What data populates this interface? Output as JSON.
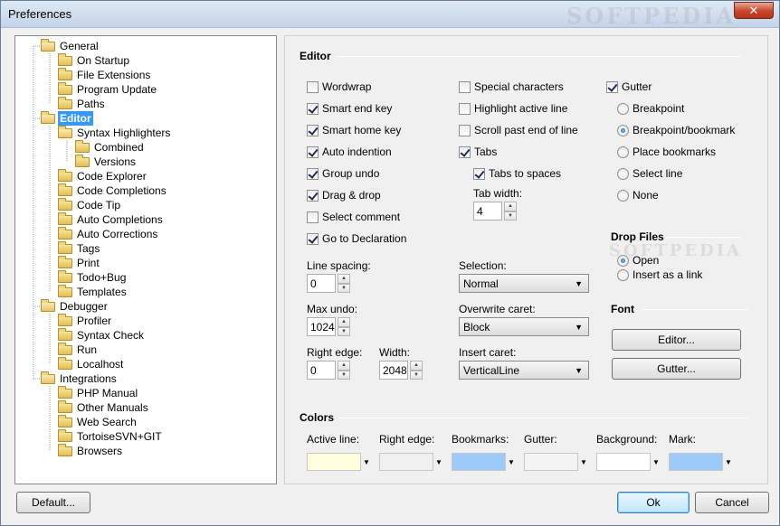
{
  "window": {
    "title": "Preferences",
    "close_glyph": "✕"
  },
  "watermark": "SOFTPEDIA",
  "tree": [
    {
      "label": "General",
      "level": 0,
      "open": true
    },
    {
      "label": "On Startup",
      "level": 1
    },
    {
      "label": "File Extensions",
      "level": 1
    },
    {
      "label": "Program Update",
      "level": 1
    },
    {
      "label": "Paths",
      "level": 1
    },
    {
      "label": "Editor",
      "level": 0,
      "open": true,
      "selected": true
    },
    {
      "label": "Syntax Highlighters",
      "level": 1,
      "open": true
    },
    {
      "label": "Combined",
      "level": 2
    },
    {
      "label": "Versions",
      "level": 2
    },
    {
      "label": "Code Explorer",
      "level": 1
    },
    {
      "label": "Code Completions",
      "level": 1
    },
    {
      "label": "Code Tip",
      "level": 1
    },
    {
      "label": "Auto Completions",
      "level": 1
    },
    {
      "label": "Auto Corrections",
      "level": 1
    },
    {
      "label": "Tags",
      "level": 1
    },
    {
      "label": "Print",
      "level": 1
    },
    {
      "label": "Todo+Bug",
      "level": 1
    },
    {
      "label": "Templates",
      "level": 1
    },
    {
      "label": "Debugger",
      "level": 0,
      "open": true
    },
    {
      "label": "Profiler",
      "level": 1
    },
    {
      "label": "Syntax Check",
      "level": 1
    },
    {
      "label": "Run",
      "level": 1
    },
    {
      "label": "Localhost",
      "level": 1
    },
    {
      "label": "Integrations",
      "level": 0,
      "open": true
    },
    {
      "label": "PHP Manual",
      "level": 1
    },
    {
      "label": "Other Manuals",
      "level": 1
    },
    {
      "label": "Web Search",
      "level": 1
    },
    {
      "label": "TortoiseSVN+GIT",
      "level": 1
    },
    {
      "label": "Browsers",
      "level": 1
    }
  ],
  "editor": {
    "title": "Editor",
    "col1": [
      {
        "label": "Wordwrap",
        "checked": false
      },
      {
        "label": "Smart end key",
        "checked": true
      },
      {
        "label": "Smart home key",
        "checked": true
      },
      {
        "label": "Auto indention",
        "checked": true
      },
      {
        "label": "Group undo",
        "checked": true
      },
      {
        "label": "Drag & drop",
        "checked": true
      },
      {
        "label": "Select comment",
        "checked": false
      },
      {
        "label": "Go to Declaration",
        "checked": true
      }
    ],
    "col2": [
      {
        "label": "Special characters",
        "checked": false
      },
      {
        "label": "Highlight active line",
        "checked": false
      },
      {
        "label": "Scroll past end of line",
        "checked": false
      },
      {
        "label": "Tabs",
        "checked": true
      }
    ],
    "tabs_to_spaces": {
      "label": "Tabs to spaces",
      "checked": true
    },
    "tab_width": {
      "label": "Tab width:",
      "value": "4"
    },
    "gutter": {
      "label": "Gutter",
      "checked": true
    },
    "gutter_options": [
      {
        "label": "Breakpoint",
        "selected": false
      },
      {
        "label": "Breakpoint/bookmark",
        "selected": true
      },
      {
        "label": "Place bookmarks",
        "selected": false
      },
      {
        "label": "Select line",
        "selected": false
      },
      {
        "label": "None",
        "selected": false
      }
    ],
    "line_spacing": {
      "label": "Line spacing:",
      "value": "0"
    },
    "max_undo": {
      "label": "Max undo:",
      "value": "1024"
    },
    "right_edge": {
      "label": "Right edge:",
      "value": "0"
    },
    "width": {
      "label": "Width:",
      "value": "2048"
    },
    "selection": {
      "label": "Selection:",
      "value": "Normal"
    },
    "overwrite_caret": {
      "label": "Overwrite caret:",
      "value": "Block"
    },
    "insert_caret": {
      "label": "Insert caret:",
      "value": "VerticalLine"
    }
  },
  "drop_files": {
    "title": "Drop Files",
    "options": [
      {
        "label": "Open",
        "selected": true
      },
      {
        "label": "Insert as a link",
        "selected": false
      }
    ]
  },
  "font": {
    "title": "Font",
    "editor_button": "Editor...",
    "gutter_button": "Gutter..."
  },
  "colors": {
    "title": "Colors",
    "items": [
      {
        "label": "Active line:",
        "color": "#ffffdd"
      },
      {
        "label": "Right edge:",
        "color": "#f0f0f0"
      },
      {
        "label": "Bookmarks:",
        "color": "#9dcaf8"
      },
      {
        "label": "Gutter:",
        "color": "#f4f4f4"
      },
      {
        "label": "Background:",
        "color": "#ffffff"
      },
      {
        "label": "Mark:",
        "color": "#9dcaf8"
      }
    ]
  },
  "footer": {
    "default_button": "Default...",
    "ok_button": "Ok",
    "cancel_button": "Cancel"
  }
}
